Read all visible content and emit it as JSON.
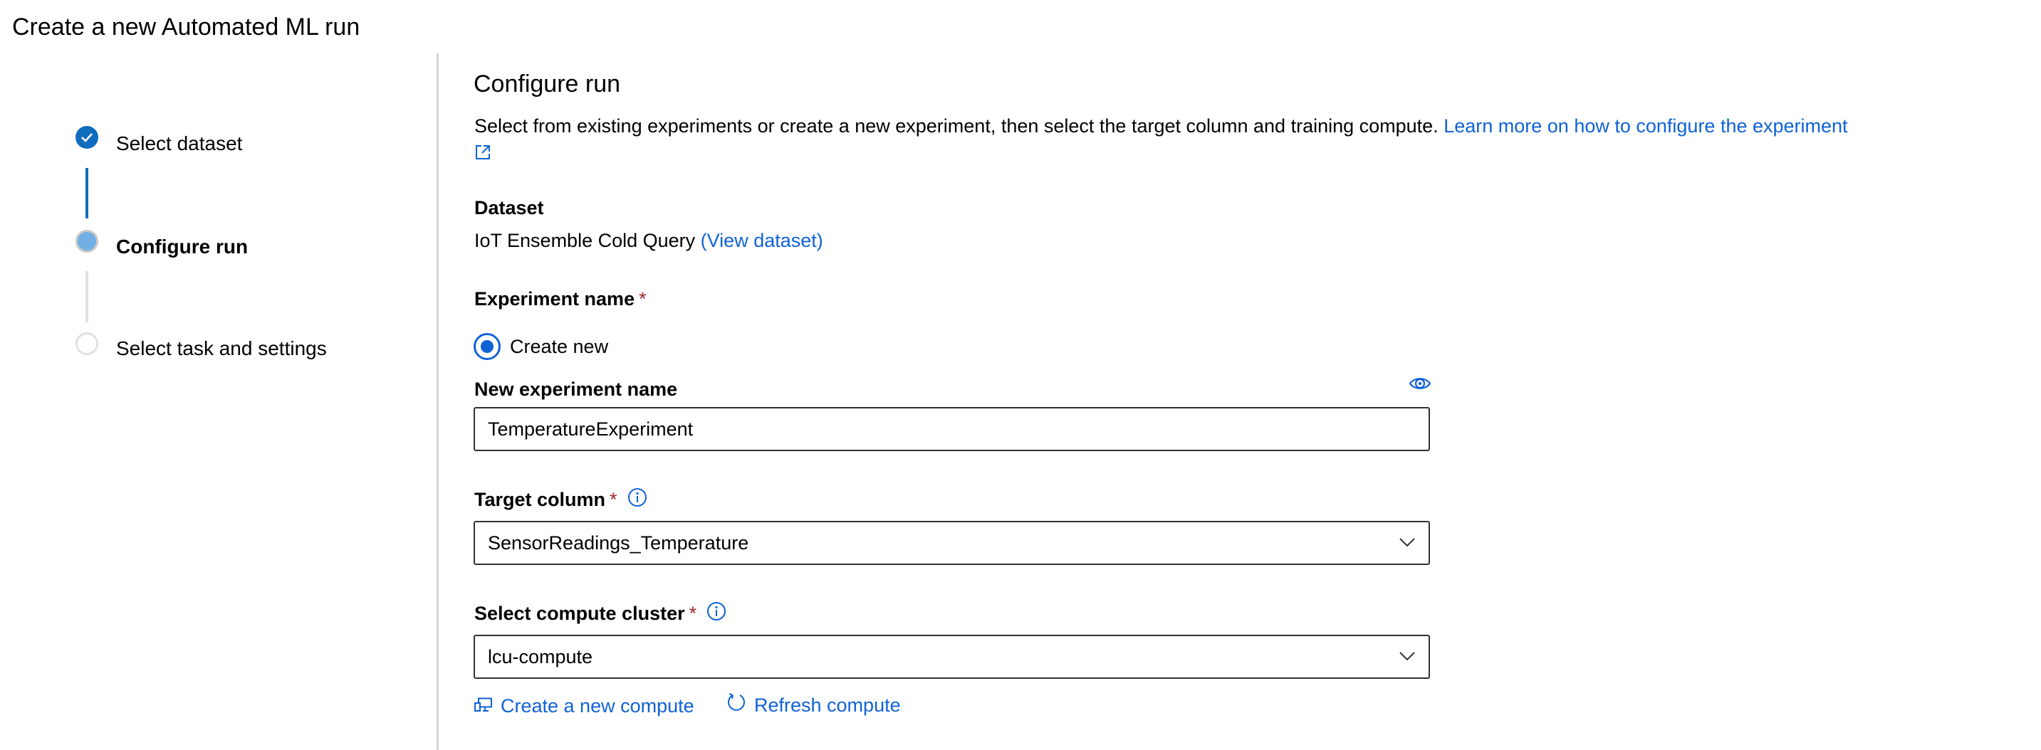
{
  "page": {
    "title": "Create a new Automated ML run"
  },
  "stepper": {
    "steps": [
      {
        "label": "Select dataset",
        "state": "completed"
      },
      {
        "label": "Configure run",
        "state": "current"
      },
      {
        "label": "Select task and settings",
        "state": "pending"
      }
    ]
  },
  "main": {
    "heading": "Configure run",
    "description": "Select from existing experiments or create a new experiment, then select the target column and training compute.",
    "learn_more_link": "Learn more on how to configure the experiment",
    "dataset": {
      "label": "Dataset",
      "value": "IoT Ensemble Cold Query",
      "view_link": "(View dataset)"
    },
    "experiment": {
      "label": "Experiment name",
      "required_marker": "*",
      "radio_option": "Create new",
      "radio_selected": true,
      "new_name_label": "New experiment name",
      "new_name_value": "TemperatureExperiment"
    },
    "target_column": {
      "label": "Target column",
      "required_marker": "*",
      "selected": "SensorReadings_Temperature"
    },
    "compute": {
      "label": "Select compute cluster",
      "required_marker": "*",
      "selected": "lcu-compute",
      "create_link": "Create a new compute",
      "refresh_link": "Refresh compute"
    }
  },
  "colors": {
    "accent": "#0f62d6",
    "step_complete": "#0f6cbd",
    "step_current": "#71afe5",
    "required": "#a4262c",
    "border": "#323130"
  }
}
